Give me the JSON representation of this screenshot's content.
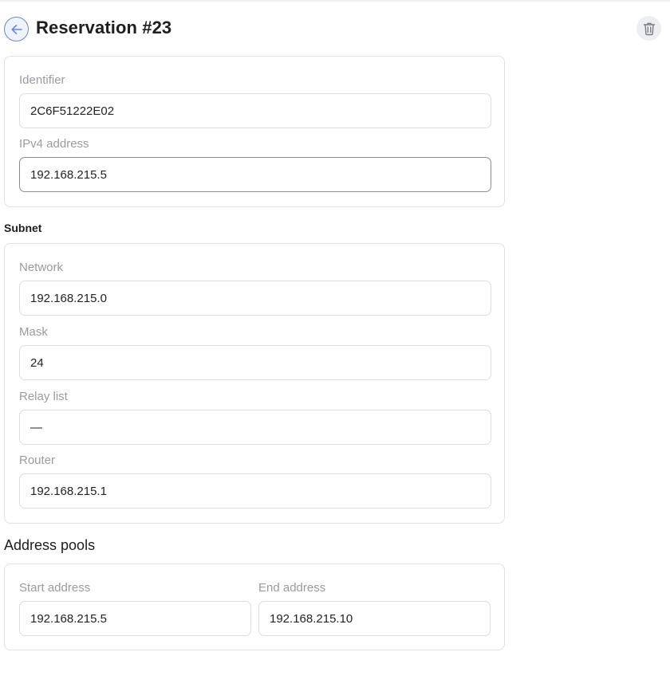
{
  "header": {
    "title": "Reservation #23",
    "back_icon": "arrow-left-icon",
    "delete_icon": "trash-icon"
  },
  "reservation": {
    "identifier_label": "Identifier",
    "identifier_value": "2C6F51222E02",
    "ipv4_label": "IPv4 address",
    "ipv4_value": "192.168.215.5"
  },
  "subnet": {
    "section_title": "Subnet",
    "network_label": "Network",
    "network_value": "192.168.215.0",
    "mask_label": "Mask",
    "mask_value": "24",
    "relay_label": "Relay list",
    "relay_value": "—",
    "router_label": "Router",
    "router_value": "192.168.215.1"
  },
  "pools": {
    "section_title": "Address pools",
    "start_label": "Start address",
    "start_value": "192.168.215.5",
    "end_label": "End address",
    "end_value": "192.168.215.10"
  },
  "colors": {
    "accent": "#6a86d6",
    "label": "#9a9aa2",
    "border": "#dfe1e7"
  }
}
